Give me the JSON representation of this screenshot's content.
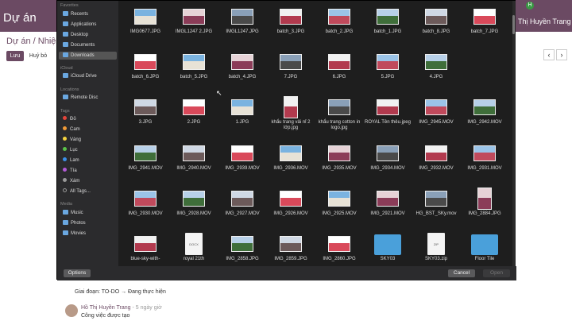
{
  "app": {
    "title": "Dự án",
    "breadcrumb": "Dự án / Nhiệm",
    "user_name": "Thị Huyền Trang",
    "avatar_letter": "H",
    "save_label": "Lưu",
    "cancel_label": "Huỷ bỏ",
    "prev_glyph": "‹",
    "next_glyph": "›",
    "stage_text": "Giai đoạn: TO-DO → Đang thực hiện",
    "author": "Hồ Thị Huyền Trang",
    "author_meta": "- 5 ngày giờ",
    "message": "Công việc được tạo"
  },
  "sidebar": {
    "favorites_title": "Favorites",
    "favorites": [
      "Recents",
      "Applications",
      "Desktop",
      "Documents",
      "Downloads"
    ],
    "icloud_title": "iCloud",
    "icloud": [
      "iCloud Drive"
    ],
    "locations_title": "Locations",
    "locations": [
      "Remote Disc"
    ],
    "tags_title": "Tags",
    "tags": [
      {
        "label": "Đỏ",
        "color": "#e5453b"
      },
      {
        "label": "Cam",
        "color": "#f09a37"
      },
      {
        "label": "Vàng",
        "color": "#f5d33f"
      },
      {
        "label": "Lục",
        "color": "#5ac24a"
      },
      {
        "label": "Lam",
        "color": "#3b8fe8"
      },
      {
        "label": "Tía",
        "color": "#b35ad6"
      },
      {
        "label": "Xám",
        "color": "#9a9a9a"
      },
      {
        "label": "All Tags...",
        "color": ""
      }
    ],
    "media_title": "Media",
    "media": [
      "Music",
      "Photos",
      "Movies"
    ]
  },
  "files": [
    [
      "IMG0677.JPG",
      "IMGL1247 2.JPG",
      "IMGL1247.JPG",
      "batch_3.JPG",
      "batch_2.JPG",
      "batch_1.JPG",
      "batch_8.JPG",
      "batch_7.JPG"
    ],
    [
      "batch_6.JPG",
      "batch_5.JPG",
      "batch_4.JPG",
      "7.JPG",
      "6.JPG",
      "5.JPG",
      "4.JPG"
    ],
    [
      "3.JPG",
      "2.JPG",
      "1.JPG",
      "khẩu trang vải nỉ 2 lớp.jpg",
      "khẩu trang cotton in logo.jpg",
      "ROYAL Tên thêu.jpeg",
      "IMG_2945.MOV",
      "IMG_2942.MOV"
    ],
    [
      "IMG_2941.MOV",
      "IMG_2940.MOV",
      "IMG_2939.MOV",
      "IMG_2936.MOV",
      "IMG_2935.MOV",
      "IMG_2934.MOV",
      "IMG_2932.MOV",
      "IMG_2931.MOV"
    ],
    [
      "IMG_2930.MOV",
      "IMG_2928.MOV",
      "IMG_2927.MOV",
      "IMG_2926.MOV",
      "IMG_2925.MOV",
      "IMG_2921.MOV",
      "HG_BST_SKy.mov",
      "IMG_2884.JPG"
    ],
    [
      "blue-sky-with-",
      "royal 21th",
      "IMG_2858.JPG",
      "IMG_2859.JPG",
      "IMG_2860.JPG",
      "SKY03",
      "SKY03.zip",
      "Floor Tile"
    ]
  ],
  "doc_badges": {
    "docx": "DOCX",
    "zip": "ZIP"
  },
  "buttons": {
    "options": "Options",
    "cancel": "Cancel",
    "open": "Open"
  }
}
